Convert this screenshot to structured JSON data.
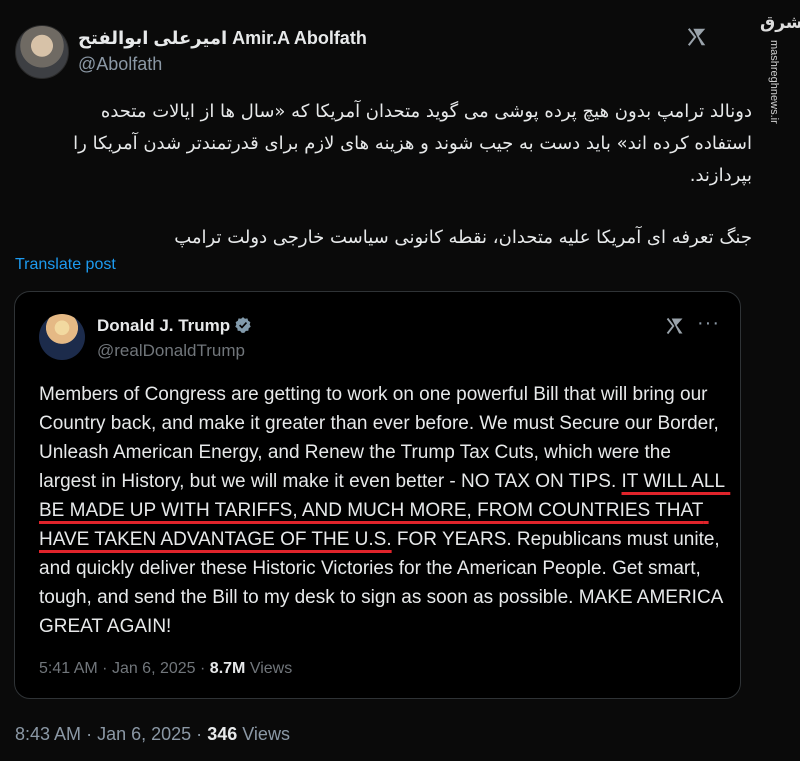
{
  "author": {
    "name": "امیرعلی ابوالفتح Amir.A Abolfath",
    "handle": "@Abolfath"
  },
  "watermark": {
    "logo_text": "مشرق",
    "site": "mashreghnews.ir"
  },
  "post": {
    "paragraph1": "دونالد ترامپ بدون هیچ پرده پوشی می گوید متحدان آمریکا که «سال ها از ایالات متحده استفاده کرده اند» باید دست به جیب شوند و هزینه های لازم برای قدرتمندتر شدن آمریکا را بپردازند.",
    "paragraph2": "جنگ تعرفه ای آمریکا علیه متحدان، نقطه کانونی سیاست خارجی دولت ترامپ",
    "translate_label": "Translate post",
    "time": "8:43 AM",
    "sep": "·",
    "date": "Jan 6, 2025",
    "views_count": "346",
    "views_label": "Views"
  },
  "quoted": {
    "name": "Donald J. Trump",
    "handle": "@realDonaldTrump",
    "more_label": "···",
    "text_before": "Members of Congress are getting to work on one powerful Bill that will bring our Country back, and make it greater than ever before. We must Secure our Border, Unleash American Energy, and Renew the Trump Tax Cuts, which were the largest in History, but we will make it even better - NO TAX ON TIPS. ",
    "text_highlight": "IT WILL ALL BE MADE UP WITH TARIFFS, AND MUCH MORE, FROM COUNTRIES THAT HAVE TAKEN ADVANTAGE OF THE U.S.",
    "text_after": " FOR YEARS. Republicans must unite, and quickly deliver these Historic Victories for the American People. Get smart, tough, and send the Bill to my desk to sign as soon as possible. MAKE AMERICA GREAT AGAIN!",
    "time": "5:41 AM",
    "sep": "·",
    "date": "Jan 6, 2025",
    "views_count": "8.7M",
    "views_label": "Views"
  },
  "icons": {
    "x_logo": "x-logo-icon",
    "verified": "verified-badge-icon",
    "more": "more-options-icon"
  },
  "colors": {
    "background": "#0a0a0a",
    "link": "#1d9bf0",
    "verified": "#829aab",
    "underline": "#e0242b",
    "muted": "#8b98a5"
  }
}
